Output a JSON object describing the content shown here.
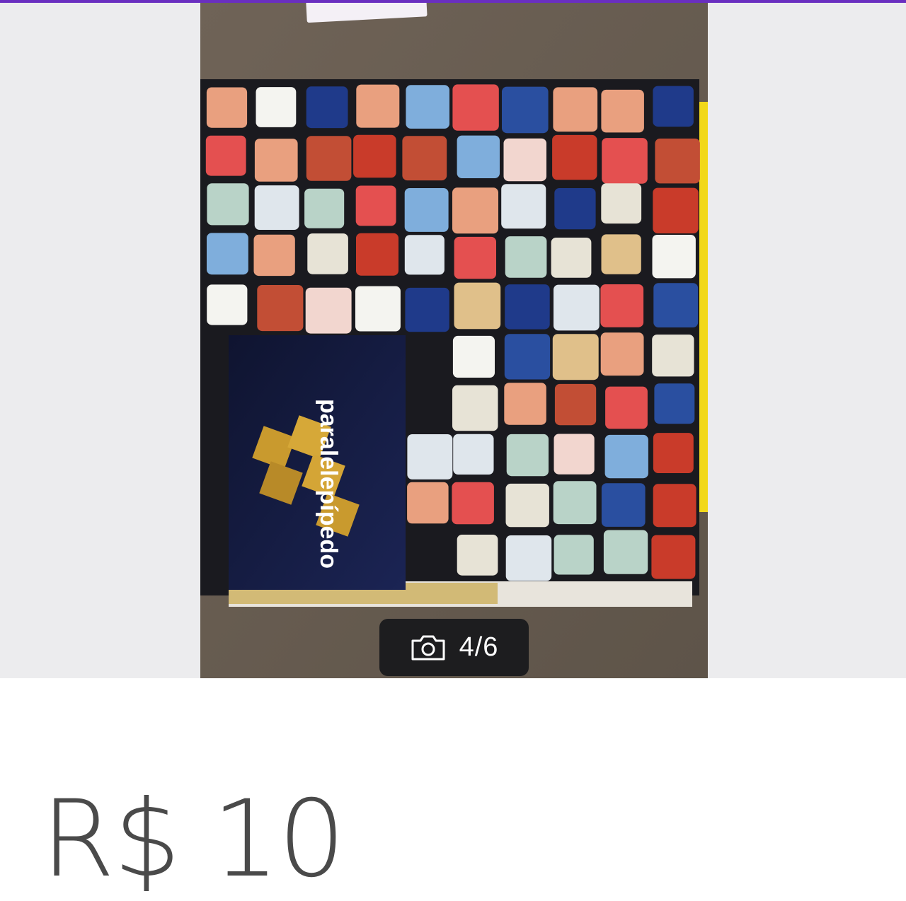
{
  "listing": {
    "photo_alt": "Parelelepípedo",
    "cover_text": "paralelepípedo",
    "photo_counter": "4/6",
    "counter_icon": "camera-icon",
    "price": "R$ 10"
  },
  "colors": {
    "accent": "#6a2fc0",
    "gallery_background": "#ececee",
    "counter_background": "#1d1d1f",
    "price_text": "#4a4a4a"
  }
}
